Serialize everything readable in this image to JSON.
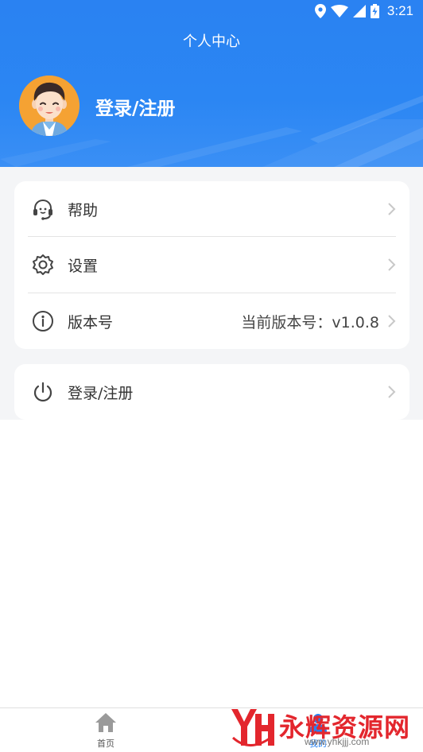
{
  "status_bar": {
    "time": "3:21",
    "icons": [
      "location-icon",
      "wifi-icon",
      "signal-icon",
      "battery-charging-icon"
    ]
  },
  "header": {
    "title": "个人中心",
    "login_label": "登录/注册",
    "avatar": "avatar-cartoon-man"
  },
  "menu": {
    "items": [
      {
        "icon": "headset-icon",
        "label": "帮助"
      },
      {
        "icon": "gear-icon",
        "label": "设置"
      },
      {
        "icon": "info-icon",
        "label": "版本号",
        "value": "当前版本号：v1.0.8"
      }
    ]
  },
  "login_card": {
    "icon": "power-icon",
    "label": "登录/注册"
  },
  "tabbar": {
    "tabs": [
      {
        "icon": "home-icon",
        "label": "首页"
      },
      {
        "icon": "user-icon",
        "label": "我的"
      }
    ]
  },
  "watermark": {
    "logo": "YH",
    "text": "永辉资源网",
    "url": "www.yhkjjj.com"
  },
  "colors": {
    "primary": "#2a82f2",
    "avatar_bg": "#f5a233",
    "watermark_red": "#e3262d"
  }
}
